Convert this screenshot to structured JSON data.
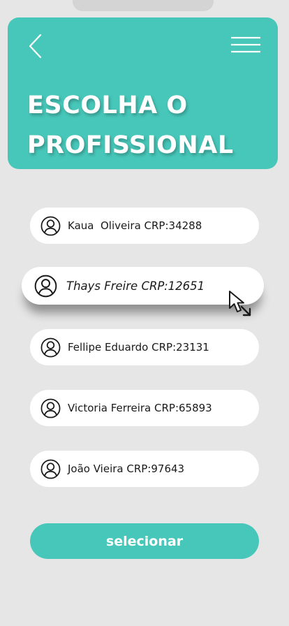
{
  "header": {
    "title_line1": "ESCOLHA O",
    "title_line2": "PROFISSIONAL",
    "back_icon": "chevron-left-icon",
    "menu_icon": "hamburger-menu-icon"
  },
  "professionals": [
    {
      "label": "Kaua  Oliveira CRP:34288",
      "selected": false
    },
    {
      "label": "Thays Freire CRP:12651",
      "selected": true
    },
    {
      "label": "Fellipe Eduardo CRP:23131",
      "selected": false
    },
    {
      "label": "Victoria Ferreira CRP:65893",
      "selected": false
    },
    {
      "label": "João Vieira CRP:97643",
      "selected": false
    }
  ],
  "action": {
    "select_label": "selecionar"
  },
  "colors": {
    "accent": "#47c7b9",
    "background": "#e6e6e6",
    "card": "#ffffff",
    "text": "#1a1a1a"
  }
}
